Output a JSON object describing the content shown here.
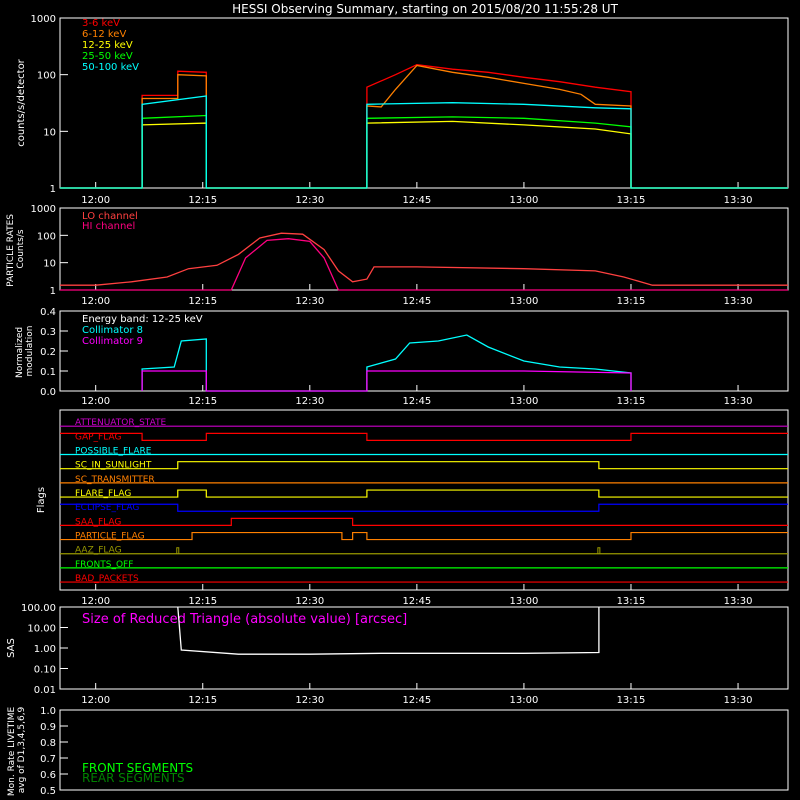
{
  "title": "HESSI Observing Summary, starting on 2015/08/20 11:55:28 UT",
  "x_ticks": [
    "12:00",
    "12:15",
    "12:30",
    "12:45",
    "13:00",
    "13:15",
    "13:30"
  ],
  "chart_data": [
    {
      "type": "line",
      "panel": "count-rates",
      "ylabel": "counts/s/detector",
      "y_ticks": [
        "1",
        "10",
        "100",
        "1000"
      ],
      "ylim": [
        1,
        1000
      ],
      "y_scale": "log",
      "legend_position": "top-left",
      "series": [
        {
          "name": "3-6 keV",
          "color": "#ff0000",
          "points": [
            [
              "11:55",
              "1"
            ],
            [
              "12:06.5",
              "1"
            ],
            [
              "12:06.5",
              "43"
            ],
            [
              "12:11.5",
              "43"
            ],
            [
              "12:11.5",
              "115"
            ],
            [
              "12:15.5",
              "110"
            ],
            [
              "12:15.5",
              "1"
            ],
            [
              "12:38",
              "1"
            ],
            [
              "12:38",
              "60"
            ],
            [
              "12:42",
              "100"
            ],
            [
              "12:45",
              "150"
            ],
            [
              "12:50",
              "125"
            ],
            [
              "12:55",
              "110"
            ],
            [
              "13:00",
              "90"
            ],
            [
              "13:05",
              "75"
            ],
            [
              "13:10",
              "60"
            ],
            [
              "13:15",
              "50"
            ],
            [
              "13:15",
              "1"
            ],
            [
              "13:37",
              "1"
            ]
          ]
        },
        {
          "name": "6-12 keV",
          "color": "#ff8000",
          "points": [
            [
              "11:55",
              "1"
            ],
            [
              "12:06.5",
              "1"
            ],
            [
              "12:06.5",
              "38"
            ],
            [
              "12:11.5",
              "38"
            ],
            [
              "12:11.5",
              "100"
            ],
            [
              "12:15.5",
              "95"
            ],
            [
              "12:15.5",
              "1"
            ],
            [
              "12:38",
              "1"
            ],
            [
              "12:38",
              "28"
            ],
            [
              "12:40",
              "27"
            ],
            [
              "12:42",
              "55"
            ],
            [
              "12:45",
              "145"
            ],
            [
              "12:50",
              "110"
            ],
            [
              "12:55",
              "90"
            ],
            [
              "13:00",
              "70"
            ],
            [
              "13:05",
              "55"
            ],
            [
              "13:08",
              "45"
            ],
            [
              "13:10",
              "30"
            ],
            [
              "13:15",
              "28"
            ],
            [
              "13:15",
              "1"
            ],
            [
              "13:37",
              "1"
            ]
          ]
        },
        {
          "name": "12-25 keV",
          "color": "#ffff00",
          "points": [
            [
              "11:55",
              "1"
            ],
            [
              "12:06.5",
              "1"
            ],
            [
              "12:06.5",
              "13"
            ],
            [
              "12:15.5",
              "14"
            ],
            [
              "12:15.5",
              "1"
            ],
            [
              "12:38",
              "1"
            ],
            [
              "12:38",
              "14"
            ],
            [
              "12:50",
              "15"
            ],
            [
              "13:00",
              "13"
            ],
            [
              "13:10",
              "11"
            ],
            [
              "13:15",
              "9"
            ],
            [
              "13:15",
              "1"
            ],
            [
              "13:37",
              "1"
            ]
          ]
        },
        {
          "name": "25-50 keV",
          "color": "#00ff00",
          "points": [
            [
              "11:55",
              "1"
            ],
            [
              "12:06.5",
              "1"
            ],
            [
              "12:06.5",
              "17"
            ],
            [
              "12:15.5",
              "19"
            ],
            [
              "12:15.5",
              "1"
            ],
            [
              "12:38",
              "1"
            ],
            [
              "12:38",
              "17"
            ],
            [
              "12:50",
              "18"
            ],
            [
              "13:00",
              "17"
            ],
            [
              "13:10",
              "14"
            ],
            [
              "13:15",
              "12"
            ],
            [
              "13:15",
              "1"
            ],
            [
              "13:37",
              "1"
            ]
          ]
        },
        {
          "name": "50-100 keV",
          "color": "#00ffff",
          "points": [
            [
              "11:55",
              "1"
            ],
            [
              "12:06.5",
              "1"
            ],
            [
              "12:06.5",
              "30"
            ],
            [
              "12:15.5",
              "42"
            ],
            [
              "12:15.5",
              "1"
            ],
            [
              "12:38",
              "1"
            ],
            [
              "12:38",
              "30"
            ],
            [
              "12:50",
              "32"
            ],
            [
              "13:00",
              "30"
            ],
            [
              "13:10",
              "26"
            ],
            [
              "13:15",
              "25"
            ],
            [
              "13:15",
              "1"
            ],
            [
              "13:37",
              "1"
            ]
          ]
        }
      ]
    },
    {
      "type": "line",
      "panel": "particle-rates",
      "ylabel": "PARTICLE RATES Counts/s",
      "y_ticks": [
        "1",
        "10",
        "100",
        "1000"
      ],
      "ylim": [
        1,
        1000
      ],
      "y_scale": "log",
      "legend_position": "top-left",
      "series": [
        {
          "name": "LO channel",
          "color": "#ff4040",
          "points": [
            [
              "11:55",
              "1.5"
            ],
            [
              "12:00",
              "1.5"
            ],
            [
              "12:05",
              "2"
            ],
            [
              "12:10",
              "3"
            ],
            [
              "12:13",
              "6"
            ],
            [
              "12:17",
              "8"
            ],
            [
              "12:20",
              "20"
            ],
            [
              "12:23",
              "80"
            ],
            [
              "12:26",
              "120"
            ],
            [
              "12:29",
              "110"
            ],
            [
              "12:32",
              "30"
            ],
            [
              "12:34",
              "5"
            ],
            [
              "12:36",
              "2"
            ],
            [
              "12:38",
              "2.5"
            ],
            [
              "12:39",
              "7"
            ],
            [
              "12:45",
              "7"
            ],
            [
              "13:00",
              "6"
            ],
            [
              "13:10",
              "5"
            ],
            [
              "13:14",
              "3"
            ],
            [
              "13:18",
              "1.5"
            ],
            [
              "13:37",
              "1.5"
            ]
          ]
        },
        {
          "name": "HI channel",
          "color": "#ff0080",
          "points": [
            [
              "11:55",
              "1"
            ],
            [
              "12:19",
              "1"
            ],
            [
              "12:21",
              "15"
            ],
            [
              "12:24",
              "65"
            ],
            [
              "12:27",
              "75"
            ],
            [
              "12:30",
              "60"
            ],
            [
              "12:32",
              "15"
            ],
            [
              "12:34",
              "1"
            ],
            [
              "13:37",
              "1"
            ]
          ]
        }
      ]
    },
    {
      "type": "line",
      "panel": "modulation",
      "ylabel": "Normalized modulation",
      "annotation": "Energy band: 12-25 keV",
      "y_ticks": [
        "0.0",
        "0.1",
        "0.2",
        "0.3",
        "0.4"
      ],
      "ylim": [
        0,
        0.4
      ],
      "legend_position": "top-left",
      "series": [
        {
          "name": "Collimator 8",
          "color": "#00ffff",
          "points": [
            [
              "12:06.5",
              "0"
            ],
            [
              "12:06.5",
              "0.11"
            ],
            [
              "12:11",
              "0.12"
            ],
            [
              "12:12",
              "0.25"
            ],
            [
              "12:15.5",
              "0.26"
            ],
            [
              "12:15.5",
              "0"
            ],
            [
              "12:38",
              "0"
            ],
            [
              "12:38",
              "0.12"
            ],
            [
              "12:42",
              "0.16"
            ],
            [
              "12:44",
              "0.24"
            ],
            [
              "12:48",
              "0.25"
            ],
            [
              "12:52",
              "0.28"
            ],
            [
              "12:55",
              "0.22"
            ],
            [
              "13:00",
              "0.15"
            ],
            [
              "13:05",
              "0.12"
            ],
            [
              "13:10",
              "0.11"
            ],
            [
              "13:15",
              "0.09"
            ],
            [
              "13:15",
              "0"
            ]
          ]
        },
        {
          "name": "Collimator 9",
          "color": "#ff00ff",
          "points": [
            [
              "12:06.5",
              "0"
            ],
            [
              "12:06.5",
              "0.1"
            ],
            [
              "12:15.5",
              "0.1"
            ],
            [
              "12:15.5",
              "0"
            ],
            [
              "12:38",
              "0"
            ],
            [
              "12:38",
              "0.1"
            ],
            [
              "13:00",
              "0.1"
            ],
            [
              "13:15",
              "0.09"
            ],
            [
              "13:15",
              "0"
            ]
          ]
        }
      ]
    },
    {
      "type": "line",
      "panel": "flags",
      "ylabel": "Flags",
      "series": [
        {
          "name": "ATTENUATOR_STATE",
          "color": "#cc00cc",
          "segments": [
            [
              "11:55",
              "13:37",
              "0"
            ]
          ]
        },
        {
          "name": "GAP_FLAG",
          "color": "#ff0000",
          "segments": [
            [
              "11:55",
              "12:06.5",
              "1"
            ],
            [
              "12:06.5",
              "12:15.5",
              "0"
            ],
            [
              "12:15.5",
              "12:38",
              "1"
            ],
            [
              "12:38",
              "13:15",
              "0"
            ],
            [
              "13:15",
              "13:37",
              "1"
            ]
          ]
        },
        {
          "name": "POSSIBLE_FLARE",
          "color": "#00ffff",
          "segments": [
            [
              "11:55",
              "13:37",
              "0"
            ]
          ]
        },
        {
          "name": "SC_IN_SUNLIGHT",
          "color": "#ffff00",
          "segments": [
            [
              "11:55",
              "12:11.5",
              "0"
            ],
            [
              "12:11.5",
              "13:10.5",
              "1"
            ],
            [
              "13:10.5",
              "13:37",
              "0"
            ]
          ]
        },
        {
          "name": "SC_TRANSMITTER",
          "color": "#ff8000",
          "segments": [
            [
              "11:55",
              "13:37",
              "0"
            ]
          ]
        },
        {
          "name": "FLARE_FLAG",
          "color": "#ffff00",
          "segments": [
            [
              "11:55",
              "12:11.5",
              "0"
            ],
            [
              "12:11.5",
              "12:15.5",
              "1"
            ],
            [
              "12:15.5",
              "12:38",
              "0"
            ],
            [
              "12:38",
              "13:10.5",
              "1"
            ],
            [
              "13:10.5",
              "13:37",
              "0"
            ]
          ]
        },
        {
          "name": "ECLIPSE_FLAG",
          "color": "#0000ff",
          "segments": [
            [
              "11:55",
              "12:11.5",
              "1"
            ],
            [
              "12:11.5",
              "13:10.5",
              "0"
            ],
            [
              "13:10.5",
              "13:37",
              "1"
            ]
          ]
        },
        {
          "name": "SAA_FLAG",
          "color": "#ff0000",
          "segments": [
            [
              "11:55",
              "12:19",
              "0"
            ],
            [
              "12:19",
              "12:36",
              "1"
            ],
            [
              "12:36",
              "13:37",
              "0"
            ]
          ]
        },
        {
          "name": "PARTICLE_FLAG",
          "color": "#ff8000",
          "segments": [
            [
              "11:55",
              "12:13.5",
              "0"
            ],
            [
              "12:13.5",
              "12:34.5",
              "1"
            ],
            [
              "12:34.5",
              "12:36",
              "0"
            ],
            [
              "12:36",
              "12:38",
              "1"
            ],
            [
              "12:38",
              "13:15",
              "0"
            ],
            [
              "13:15",
              "13:37",
              "1"
            ]
          ]
        },
        {
          "name": "AAZ_FLAG",
          "color": "#999900",
          "segments": [
            [
              "11:55",
              "13:37",
              "0"
            ]
          ],
          "spikes": [
            "12:11.5",
            "13:10.5"
          ]
        },
        {
          "name": "FRONTS_OFF",
          "color": "#00ff00",
          "segments": [
            [
              "11:55",
              "13:37",
              "0"
            ]
          ]
        },
        {
          "name": "BAD_PACKETS",
          "color": "#ff0000",
          "segments": [
            [
              "11:55",
              "13:37",
              "0"
            ]
          ]
        }
      ]
    },
    {
      "type": "line",
      "panel": "sas",
      "ylabel": "SAS",
      "annotation": "Size of Reduced Triangle (absolute value) [arcsec]",
      "y_ticks": [
        "0.01",
        "0.10",
        "1.00",
        "10.00",
        "100.00"
      ],
      "ylim": [
        0.01,
        100
      ],
      "y_scale": "log",
      "series": [
        {
          "name": "",
          "color": "#ffffff",
          "points": [
            [
              "12:11.5",
              "100"
            ],
            [
              "12:12",
              "0.8"
            ],
            [
              "12:20",
              "0.5"
            ],
            [
              "12:30",
              "0.5"
            ],
            [
              "12:40",
              "0.55"
            ],
            [
              "13:00",
              "0.55"
            ],
            [
              "13:10.5",
              "0.6"
            ],
            [
              "13:10.5",
              "100"
            ]
          ]
        }
      ]
    },
    {
      "type": "line",
      "panel": "monitor-rate",
      "ylabel": "Mon. Rate LIVETIME avg of D1,3,4,5,6,9",
      "y_ticks": [
        "0.5",
        "0.6",
        "0.7",
        "0.8",
        "0.9",
        "1.0"
      ],
      "ylim": [
        0.5,
        1.0
      ],
      "legend_position": "bottom-left",
      "series": [
        {
          "name": "FRONT SEGMENTS",
          "color": "#00ff00",
          "points": []
        },
        {
          "name": "REAR SEGMENTS",
          "color": "#008000",
          "points": []
        }
      ]
    }
  ]
}
